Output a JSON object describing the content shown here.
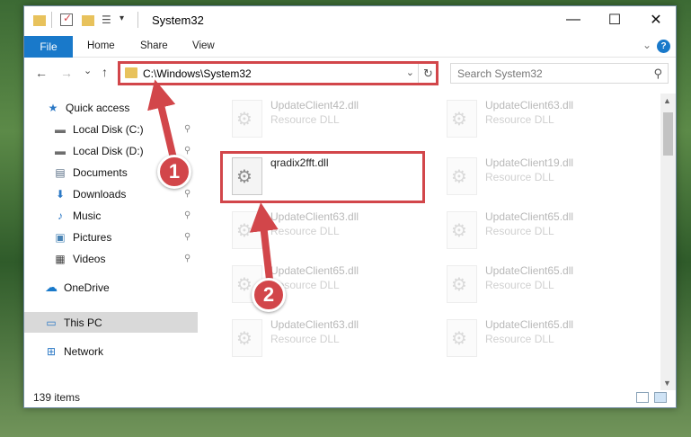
{
  "window": {
    "title": "System32",
    "controls": {
      "minimize": "—",
      "maximize": "☐",
      "close": "✕"
    }
  },
  "ribbon": {
    "file_tab": "File",
    "tabs": [
      "Home",
      "Share",
      "View"
    ],
    "expand": "⌄",
    "help": "?"
  },
  "address_bar": {
    "path": "C:\\Windows\\System32",
    "dropdown": "⌄",
    "refresh": "↻"
  },
  "search": {
    "placeholder": "Search System32",
    "icon": "search-icon"
  },
  "nav_buttons": {
    "back": "←",
    "forward": "→",
    "recent": "⌄",
    "up": "↑"
  },
  "navigation_pane": {
    "items": [
      {
        "label": "Quick access",
        "icon": "star-icon",
        "icon_glyph": "★",
        "color": "#2b78c5",
        "pinned": false
      },
      {
        "label": "Local Disk (C:)",
        "icon": "drive-icon",
        "icon_glyph": "▬",
        "color": "#6e6e6e",
        "pinned": true
      },
      {
        "label": "Local Disk (D:)",
        "icon": "drive-icon",
        "icon_glyph": "▬",
        "color": "#6e6e6e",
        "pinned": true
      },
      {
        "label": "Documents",
        "icon": "documents-icon",
        "icon_glyph": "▤",
        "color": "#5a6f86",
        "pinned": true
      },
      {
        "label": "Downloads",
        "icon": "downloads-icon",
        "icon_glyph": "⬇",
        "color": "#2b78c5",
        "pinned": true
      },
      {
        "label": "Music",
        "icon": "music-icon",
        "icon_glyph": "♪",
        "color": "#2b78c5",
        "pinned": true
      },
      {
        "label": "Pictures",
        "icon": "pictures-icon",
        "icon_glyph": "▣",
        "color": "#4a84b5",
        "pinned": true
      },
      {
        "label": "Videos",
        "icon": "videos-icon",
        "icon_glyph": "▦",
        "color": "#444444",
        "pinned": true
      },
      {
        "label": "OneDrive",
        "icon": "onedrive-icon",
        "icon_glyph": "☁",
        "color": "#1979ca",
        "pinned": false
      },
      {
        "label": "This PC",
        "icon": "computer-icon",
        "icon_glyph": "▭",
        "color": "#2b78c5",
        "pinned": false
      },
      {
        "label": "Network",
        "icon": "network-icon",
        "icon_glyph": "⊞",
        "color": "#2b78c5",
        "pinned": false
      }
    ],
    "pin_glyph": "📌"
  },
  "files": [
    {
      "name": "UpdateClient42.dll",
      "type": "Resource DLL",
      "faded": true
    },
    {
      "name": "UpdateClient63.dll",
      "type": "Resource DLL",
      "faded": true
    },
    {
      "name": "qradix2fft.dll",
      "type": "",
      "faded": false
    },
    {
      "name": "UpdateClient19.dll",
      "type": "Resource DLL",
      "faded": true
    },
    {
      "name": "UpdateClient63.dll",
      "type": "Resource DLL",
      "faded": true
    },
    {
      "name": "UpdateClient65.dll",
      "type": "Resource DLL",
      "faded": true
    },
    {
      "name": "UpdateClient65.dll",
      "type": "Resource DLL",
      "faded": true
    },
    {
      "name": "UpdateClient65.dll",
      "type": "Resource DLL",
      "faded": true
    },
    {
      "name": "UpdateClient63.dll",
      "type": "Resource DLL",
      "faded": true
    },
    {
      "name": "UpdateClient65.dll",
      "type": "Resource DLL",
      "faded": true
    }
  ],
  "status_bar": {
    "item_count": "139 items"
  },
  "annotations": {
    "step1": "1",
    "step2": "2",
    "highlight_color": "#d2464a"
  }
}
